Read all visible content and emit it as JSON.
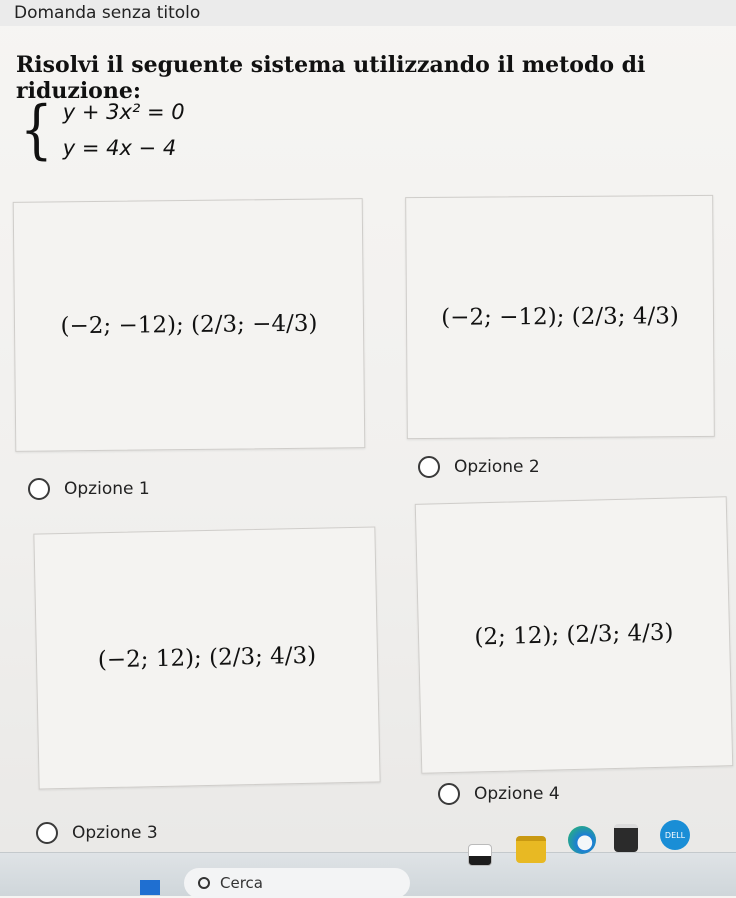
{
  "window": {
    "title": "Domanda senza titolo"
  },
  "question": {
    "text": "Risolvi il seguente sistema utilizzando il metodo di riduzione:",
    "equations": [
      "y + 3x² = 0",
      "y = 4x − 4"
    ]
  },
  "options": [
    {
      "label": "Opzione 1",
      "answer": "(−2; −12); (2/3; −4/3)",
      "selected": false
    },
    {
      "label": "Opzione 2",
      "answer": "(−2; −12); (2/3; 4/3)",
      "selected": false
    },
    {
      "label": "Opzione 3",
      "answer": "(−2; 12); (2/3; 4/3)",
      "selected": false
    },
    {
      "label": "Opzione 4",
      "answer": "(2; 12); (2/3; 4/3)",
      "selected": false
    }
  ],
  "taskbar": {
    "search_label": "Cerca",
    "icons": [
      "windows-start-icon",
      "task-view-icon",
      "file-explorer-icon",
      "edge-icon",
      "store-icon",
      "dell-icon"
    ],
    "dell_logo_text": "DELL"
  },
  "colors": {
    "card_background": "#f4f3f1",
    "card_border": "#cfcdca",
    "page_background": "#f3f2f0",
    "taskbar_background": "#d7dde0",
    "start_button": "#1f6fd1"
  }
}
